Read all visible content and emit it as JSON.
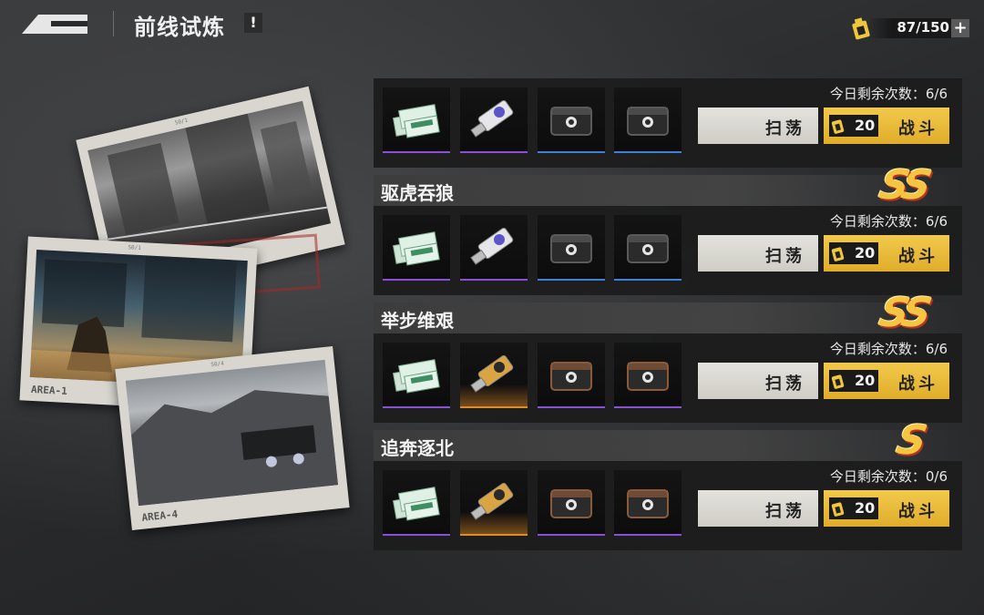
{
  "header": {
    "title": "前线试炼",
    "info_label": "!"
  },
  "stamina": {
    "value": "87/150",
    "plus_label": "+"
  },
  "photos": [
    {
      "caption": "",
      "code": "S0/1"
    },
    {
      "caption": "AREA-1",
      "code": "S0/1"
    },
    {
      "caption": "AREA-4",
      "code": "S0/4"
    }
  ],
  "stages": [
    {
      "name": "",
      "grade": "",
      "remain": "今日剩余次数：6/6",
      "sweep_label": "扫荡",
      "fight_label": "战斗",
      "cost": "20",
      "rewards": [
        "cash-bundle",
        "usb-drive-purple",
        "supply-crate-blue",
        "supply-crate-blue"
      ],
      "reward_colors": [
        "#8a4fd8",
        "#8a4fd8",
        "#3d7fd9",
        "#3d7fd9"
      ]
    },
    {
      "name": "驱虎吞狼",
      "grade": "SS",
      "remain": "今日剩余次数：6/6",
      "sweep_label": "扫荡",
      "fight_label": "战斗",
      "cost": "20",
      "rewards": [
        "cash-bundle",
        "usb-drive-purple",
        "supply-crate-blue",
        "supply-crate-blue"
      ],
      "reward_colors": [
        "#8a4fd8",
        "#8a4fd8",
        "#3d7fd9",
        "#3d7fd9"
      ]
    },
    {
      "name": "举步维艰",
      "grade": "SS",
      "remain": "今日剩余次数：6/6",
      "sweep_label": "扫荡",
      "fight_label": "战斗",
      "cost": "20",
      "rewards": [
        "cash-bundle",
        "usb-drive-gold",
        "supply-crate-purple",
        "supply-crate-purple"
      ],
      "reward_colors": [
        "#8a4fd8",
        "#e08a2a",
        "#8a4fd8",
        "#8a4fd8"
      ]
    },
    {
      "name": "追奔逐北",
      "grade": "S",
      "remain": "今日剩余次数：0/6",
      "sweep_label": "扫荡",
      "fight_label": "战斗",
      "cost": "20",
      "rewards": [
        "cash-bundle",
        "usb-drive-gold",
        "supply-crate-purple",
        "supply-crate-purple"
      ],
      "reward_colors": [
        "#8a4fd8",
        "#e08a2a",
        "#8a4fd8",
        "#8a4fd8"
      ]
    }
  ]
}
